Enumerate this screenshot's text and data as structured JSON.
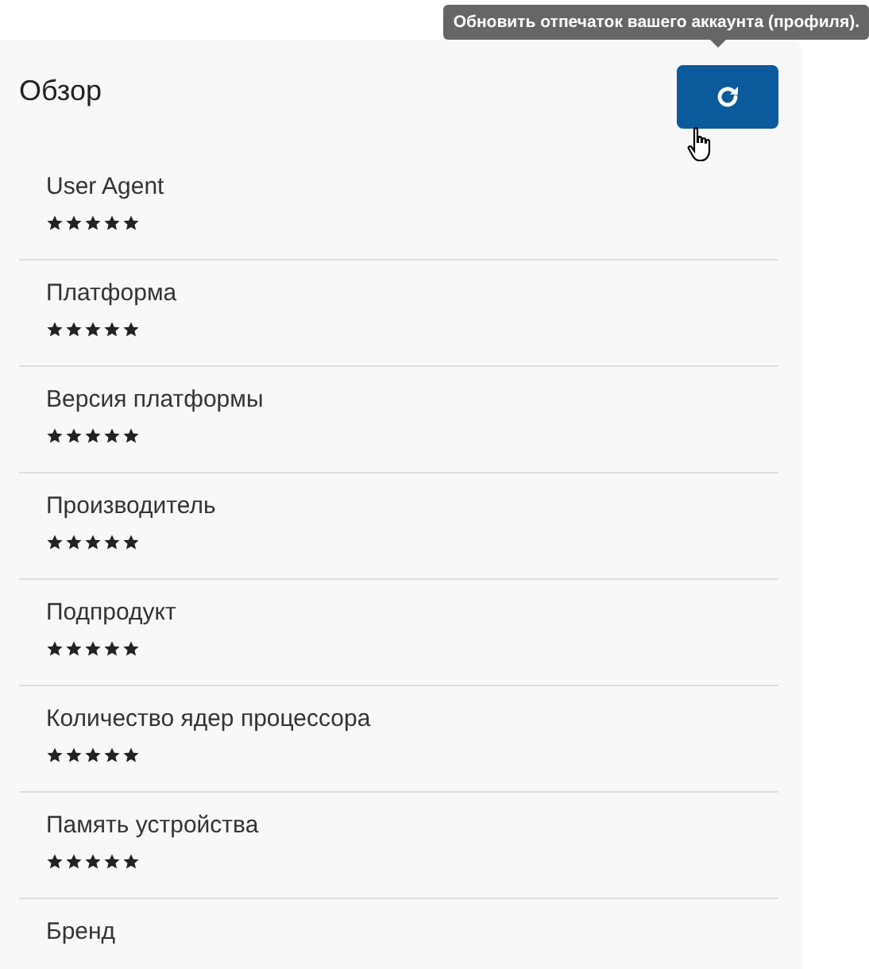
{
  "card": {
    "title": "Обзор",
    "refresh_button": {
      "tooltip": "Обновить отпечаток вашего аккаунта (профиля)."
    },
    "items": [
      {
        "label": "User Agent",
        "stars": 5
      },
      {
        "label": "Платформа",
        "stars": 5
      },
      {
        "label": "Версия платформы",
        "stars": 5
      },
      {
        "label": "Производитель",
        "stars": 5
      },
      {
        "label": "Подпродукт",
        "stars": 5
      },
      {
        "label": "Количество ядер процессора",
        "stars": 5
      },
      {
        "label": "Память устройства",
        "stars": 5
      },
      {
        "label": "Бренд"
      }
    ]
  }
}
